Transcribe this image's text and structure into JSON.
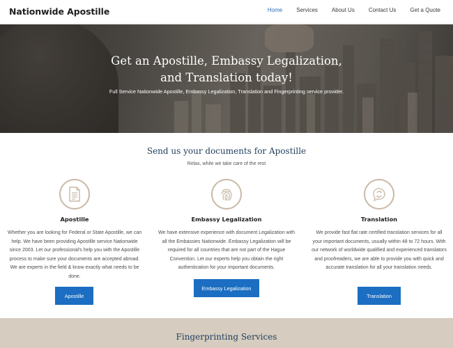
{
  "header": {
    "brand": "Nationwide Apostille",
    "nav": [
      "Home",
      "Services",
      "About Us",
      "Contact Us",
      "Get a Quote"
    ],
    "active_index": 0
  },
  "hero": {
    "title_line1": "Get an Apostille, Embassy Legalization,",
    "title_line2": "and Translation today!",
    "subtitle": "Full Service Nationwide Apostille, Embassy Legalization, Translation and Fingerprinting service provider."
  },
  "section": {
    "title": "Send us your documents for Apostille",
    "subtitle": "Relax, while we take care of the rest"
  },
  "services": [
    {
      "icon": "document-icon",
      "title": "Apostille",
      "text": "Whether you are looking for Federal or State Apostille, we can help. We have been providing Apostille service Nationwide since 2003. Let our professional's help you with the Apostille process to make sure your documents are accepted abroad. We are experts in the field & know exactly what needs to be done.",
      "button": "Apostille"
    },
    {
      "icon": "fingerprint-icon",
      "title": "Embassy Legalization",
      "text": "We have extensive experience with document Legalization with all the Embassies Nationwide. Embassy Legalization will be required for all countries that are not part of the Hague Convention. Let our experts help you obtain the right authentication for your important documents.",
      "button": "Embassy Legalization"
    },
    {
      "icon": "translation-chat-icon",
      "title": "Translation",
      "text": "We provide fast flat rate certified translation services for all your important documents, usually within 48 to 72 hours. With our network of worldwide qualified and experienced translators and proofreaders, we are able to provide you with quick and accurate translation for all your translation needs.",
      "button": "Translation"
    }
  ],
  "fingerprinting": {
    "title": "Fingerprinting Services"
  },
  "colors": {
    "accent": "#1b6ec2",
    "nav_active": "#2a6fb6",
    "heading": "#1e3d5c",
    "icon_ring": "#c8b9a7",
    "band": "#d6ccbf"
  }
}
